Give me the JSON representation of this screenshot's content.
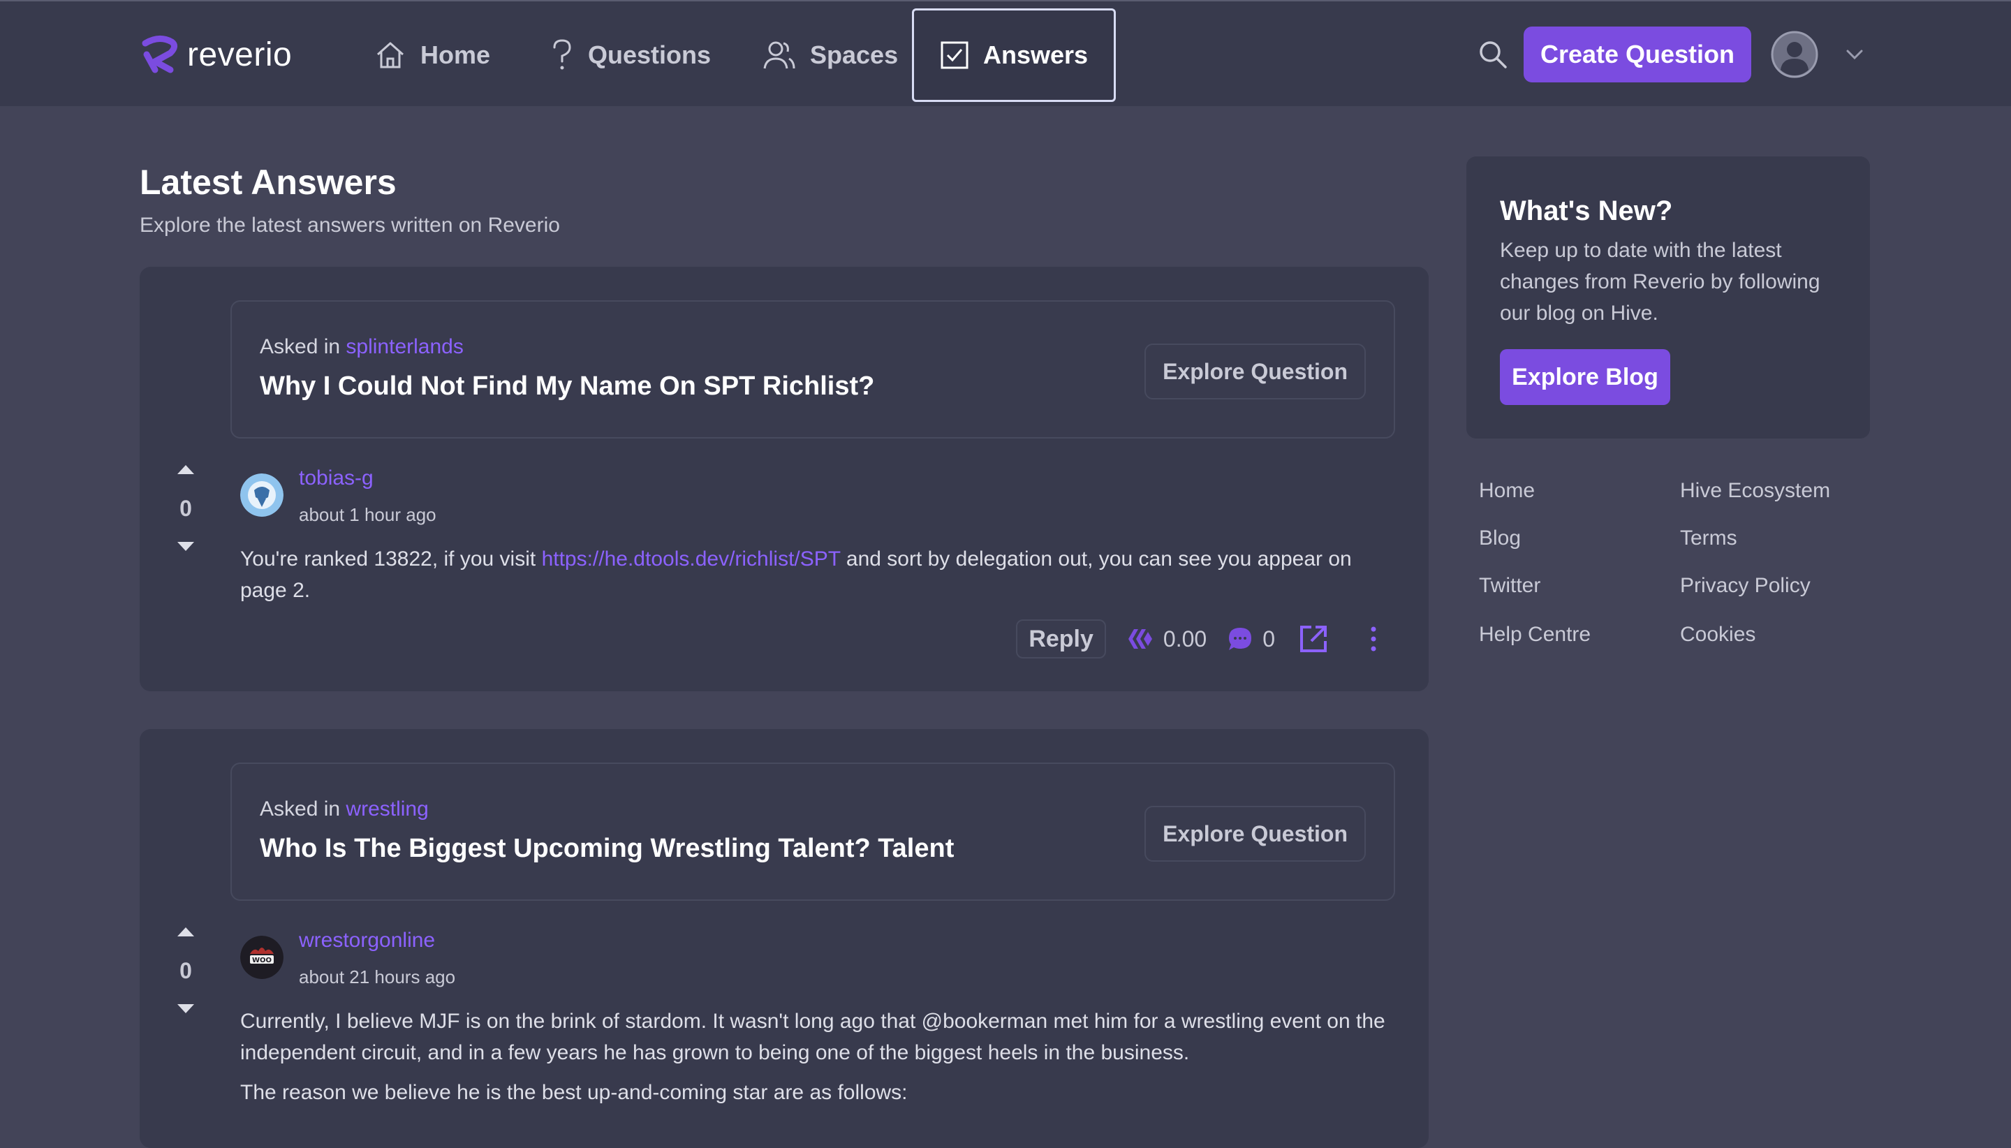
{
  "brand": {
    "name": "reverio",
    "accent": "#7b4ce0",
    "link_color": "#8c62ff"
  },
  "nav": {
    "items": [
      {
        "label": "Home",
        "icon": "home-icon"
      },
      {
        "label": "Questions",
        "icon": "question-icon"
      },
      {
        "label": "Spaces",
        "icon": "users-icon"
      },
      {
        "label": "Answers",
        "icon": "checkbox-icon",
        "active": true
      }
    ],
    "create_label": "Create Question"
  },
  "page": {
    "title": "Latest Answers",
    "subtitle": "Explore the latest answers written on Reverio"
  },
  "answers": [
    {
      "asked_prefix": "Asked in",
      "space": "splinterlands",
      "question_title": "Why I Could Not Find My Name On SPT Richlist?",
      "explore_label": "Explore Question",
      "votes": "0",
      "author": "tobias-g",
      "time": "about 1 hour ago",
      "body_before": "You're ranked 13822, if you visit ",
      "body_link": "https://he.dtools.dev/richlist/SPT",
      "body_after": " and sort by delegation out, you can see you appear on page 2.",
      "reply_label": "Reply",
      "payout": "0.00",
      "comments": "0"
    },
    {
      "asked_prefix": "Asked in",
      "space": "wrestling",
      "question_title": "Who Is The Biggest Upcoming Wrestling Talent? Talent",
      "explore_label": "Explore Question",
      "votes": "0",
      "author": "wrestorgonline",
      "avatar_text": "WOO",
      "time": "about 21 hours ago",
      "body_p1": "Currently, I believe MJF is on the brink of stardom. It wasn't long ago that @bookerman met him for a wrestling event on the independent circuit, and in a few years he has grown to being one of the biggest heels in the business.",
      "body_p2": "The reason we believe he is the best up-and-coming star are as follows:"
    }
  ],
  "sidebar": {
    "whats_new": {
      "title": "What's New?",
      "text": "Keep up to date with the latest changes from Reverio by following our blog on Hive.",
      "button": "Explore Blog"
    },
    "links": [
      "Home",
      "Hive Ecosystem",
      "Blog",
      "Terms",
      "Twitter",
      "Privacy Policy",
      "Help Centre",
      "Cookies"
    ]
  }
}
